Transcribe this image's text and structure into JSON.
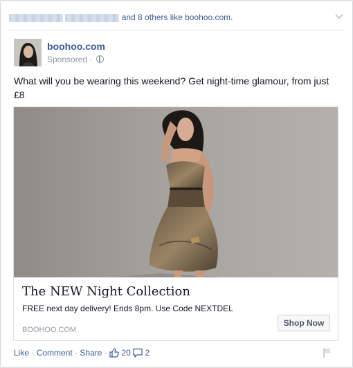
{
  "social_context": {
    "suffix": "and 8 others like boohoo.com."
  },
  "page": {
    "name": "boohoo.com",
    "meta": "Sponsored ·"
  },
  "post": {
    "text": "What will you be wearing this weekend? Get night-time glamour, from just £8"
  },
  "ad": {
    "headline": "The NEW Night Collection",
    "description": "FREE next day delivery! Ends 8pm. Use Code NEXTDEL",
    "domain": "BOOHOO.COM",
    "cta": "Shop Now"
  },
  "actions": {
    "like": "Like",
    "comment": "Comment",
    "share": "Share",
    "sep": "·",
    "like_count": "20",
    "comment_count": "2"
  },
  "colors": {
    "link": "#3b5998",
    "meta": "#9197a3",
    "text": "#141823"
  },
  "icons": [
    "chevron-down-icon",
    "globe-icon",
    "thumbs-up-icon",
    "comment-icon",
    "flag-icon"
  ]
}
